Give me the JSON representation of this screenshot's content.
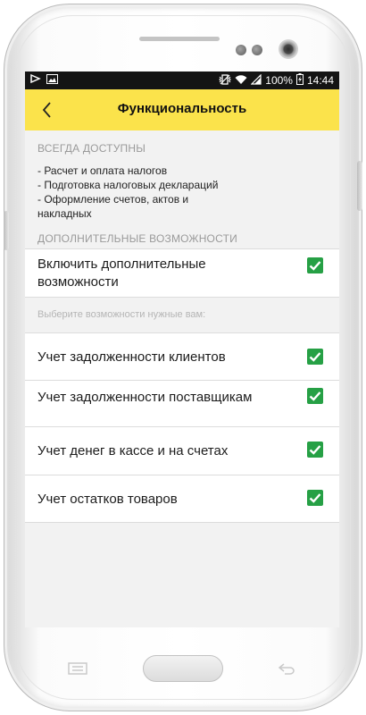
{
  "status_bar": {
    "battery": "100%",
    "time": "14:44"
  },
  "toolbar": {
    "title": "Функциональность"
  },
  "sections": {
    "always_available": {
      "header": "ВСЕГДА ДОСТУПНЫ",
      "items": [
        "- Расчет и оплата налогов",
        "- Подготовка налоговых деклараций",
        "- Оформление счетов, актов и",
        "накладных"
      ]
    },
    "additional": {
      "header": "ДОПОЛНИТЕЛЬНЫЕ ВОЗМОЖНОСТИ",
      "toggle_label": "Включить дополнительные возможности",
      "toggle_checked": true,
      "hint": "Выберите возможности нужные вам:",
      "options": [
        {
          "label": "Учет задолженности клиентов",
          "checked": true
        },
        {
          "label": "Учет задолженности поставщикам",
          "checked": true
        },
        {
          "label": "Учет денег в кассе и на счетах",
          "checked": true
        },
        {
          "label": "Учет остатков товаров",
          "checked": true
        }
      ]
    }
  },
  "colors": {
    "toolbar": "#fbe34b",
    "checkbox": "#26a045",
    "status_bar": "#141414"
  },
  "icons": {
    "back": "chevron-left-icon",
    "checkbox": "checkmark-icon",
    "status_left": [
      "notification-play-icon",
      "image-icon"
    ],
    "status_right": [
      "vibrate-icon",
      "wifi-icon",
      "signal-icon",
      "battery-charging-icon"
    ],
    "hardware": [
      "menu-key-icon",
      "home-button",
      "back-key-icon"
    ]
  }
}
